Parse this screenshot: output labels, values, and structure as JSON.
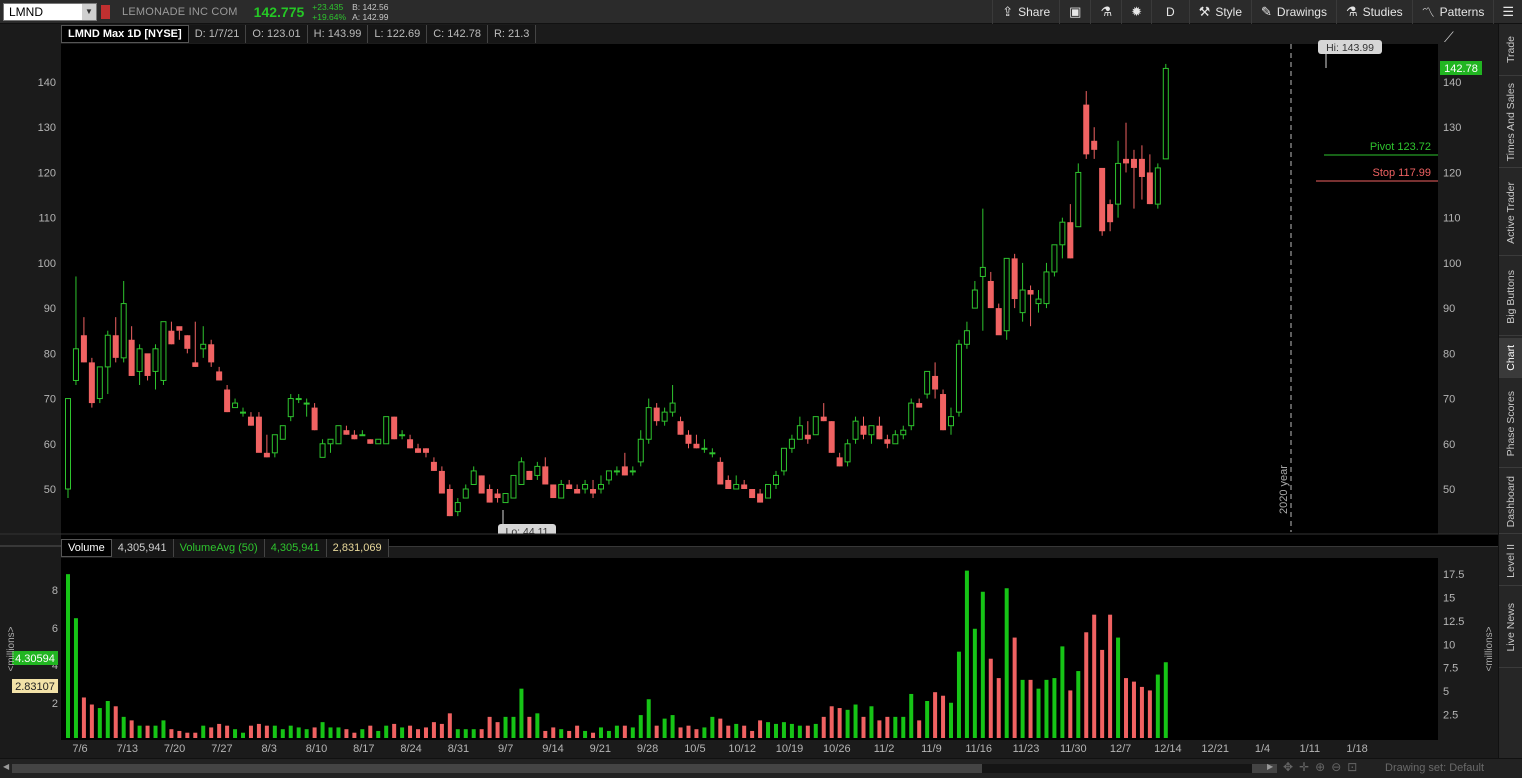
{
  "toolbar": {
    "symbol": "LMND",
    "company": "LEMONADE INC COM",
    "last": "142.775",
    "net_change": "+23.435",
    "pct_change": "+19.64%",
    "bid": "B: 142.56",
    "ask": "A: 142.99",
    "buttons": {
      "share": "Share",
      "period": "D",
      "style": "Style",
      "drawings": "Drawings",
      "studies": "Studies",
      "patterns": "Patterns"
    }
  },
  "price_header": {
    "title": "LMND Max 1D [NYSE]",
    "date": "D: 1/7/21",
    "open": "O: 123.01",
    "high": "H: 143.99",
    "low": "L: 122.69",
    "close": "C: 142.78",
    "range": "R: 21.3"
  },
  "volume_header": {
    "title": "Volume",
    "volume": "4,305,941",
    "avg_label": "VolumeAvg (50)",
    "avg_value": "4,305,941",
    "avg2": "2,831,069"
  },
  "annotations": {
    "hi": "Hi: 143.99",
    "lo": "Lo: 44.11",
    "pivot": "Pivot 123.72",
    "stop": "Stop 117.99",
    "last_price_tag": "142.78",
    "year_marker": "2020 year",
    "vol_tag_green": "4.30594",
    "vol_tag_yellow": "2.83107",
    "millions": "<millions>"
  },
  "sidebar": {
    "tabs": [
      "Trade",
      "Times And Sales",
      "Active Trader",
      "Big Buttons",
      "Chart",
      "Phase Scores",
      "Dashboard",
      "Level II",
      "Live News"
    ],
    "active": "Chart"
  },
  "status": {
    "drawing_set": "Drawing set: Default"
  },
  "colors": {
    "up": "#2ec42e",
    "down": "#f06262",
    "pivot": "#2ec42e",
    "stop": "#f06262"
  },
  "chart_data": {
    "type": "candlestick",
    "symbol": "LMND",
    "price_axis": {
      "ticks": [
        50,
        60,
        70,
        80,
        90,
        100,
        110,
        120,
        130,
        140
      ],
      "ylim": [
        40,
        148
      ]
    },
    "volume_axis_left": {
      "ticks": [
        2,
        4,
        6,
        8
      ],
      "unit": "<millions>"
    },
    "volume_axis_right": {
      "ticks": [
        "2.5",
        "5",
        "7.5",
        "10",
        "12.5",
        "15",
        "17.5"
      ],
      "unit": "<millions>"
    },
    "x_tick_labels": [
      "7/6",
      "7/13",
      "7/20",
      "7/27",
      "8/3",
      "8/10",
      "8/17",
      "8/24",
      "8/31",
      "9/7",
      "9/14",
      "9/21",
      "9/28",
      "10/5",
      "10/12",
      "10/19",
      "10/26",
      "11/2",
      "11/9",
      "11/16",
      "11/23",
      "11/30",
      "12/7",
      "12/14",
      "12/21",
      "1/4",
      "1/11",
      "1/18"
    ],
    "candles": [
      [
        50,
        70,
        48,
        70.0,
        9.3
      ],
      [
        74,
        97,
        73,
        81,
        6.8
      ],
      [
        84,
        88,
        78,
        78,
        2.3
      ],
      [
        78,
        79,
        68,
        69,
        1.9
      ],
      [
        70,
        77,
        69,
        77,
        1.7
      ],
      [
        77,
        85,
        71,
        84,
        2.1
      ],
      [
        84,
        88,
        78,
        79,
        1.8
      ],
      [
        79,
        96,
        78,
        91,
        1.2
      ],
      [
        83,
        86,
        75,
        75,
        1.0
      ],
      [
        76,
        82,
        73,
        81,
        0.7
      ],
      [
        80,
        79,
        74,
        75,
        0.7
      ],
      [
        76,
        82,
        72,
        81,
        0.7
      ],
      [
        74,
        87,
        73,
        87,
        1.0
      ],
      [
        85,
        87,
        82,
        82,
        0.5
      ],
      [
        86,
        85,
        83,
        85,
        0.4
      ],
      [
        84,
        84,
        80,
        81,
        0.3
      ],
      [
        78,
        87,
        77,
        77,
        0.3
      ],
      [
        81,
        86,
        79,
        82,
        0.7
      ],
      [
        82,
        83,
        77,
        78,
        0.6
      ],
      [
        76,
        77,
        74,
        74,
        0.8
      ],
      [
        72,
        73,
        67,
        67,
        0.7
      ],
      [
        68,
        70,
        68,
        69,
        0.5
      ],
      [
        67,
        68,
        66,
        67,
        0.3
      ],
      [
        66,
        67,
        64,
        64,
        0.7
      ],
      [
        66,
        67,
        59,
        58,
        0.8
      ],
      [
        58,
        62,
        57,
        57,
        0.7
      ],
      [
        58,
        62,
        57,
        62,
        0.7
      ],
      [
        61,
        64,
        61,
        64,
        0.5
      ],
      [
        66,
        71,
        65,
        70,
        0.7
      ],
      [
        70,
        71,
        69,
        70,
        0.6
      ],
      [
        69,
        70,
        66,
        69,
        0.5
      ],
      [
        68,
        69,
        63,
        63,
        0.6
      ],
      [
        57,
        61,
        57,
        60,
        0.9
      ],
      [
        60,
        61,
        58,
        61,
        0.6
      ],
      [
        60,
        64,
        60,
        64,
        0.6
      ],
      [
        63,
        64,
        62,
        62,
        0.5
      ],
      [
        62,
        63,
        61,
        61,
        0.3
      ],
      [
        62,
        63,
        62,
        62,
        0.5
      ],
      [
        61,
        61,
        60,
        60,
        0.7
      ],
      [
        60,
        61,
        60,
        61,
        0.4
      ],
      [
        60,
        66,
        60,
        66,
        0.7
      ],
      [
        66,
        66,
        61,
        61,
        0.8
      ],
      [
        62,
        63,
        61,
        62,
        0.6
      ],
      [
        61,
        62,
        59,
        59,
        0.7
      ],
      [
        59,
        60,
        58,
        58,
        0.5
      ],
      [
        59,
        59,
        57,
        58,
        0.6
      ],
      [
        56,
        57,
        54,
        54,
        0.9
      ],
      [
        54,
        55,
        49,
        49,
        0.8
      ],
      [
        50,
        51,
        44,
        44,
        1.4
      ],
      [
        45,
        48,
        44,
        47,
        0.5
      ],
      [
        48,
        51,
        48,
        50,
        0.5
      ],
      [
        51,
        55,
        51,
        54,
        0.5
      ],
      [
        53,
        53,
        49,
        49,
        0.5
      ],
      [
        50,
        51,
        47,
        47,
        1.2
      ],
      [
        49,
        50,
        47,
        48,
        0.9
      ],
      [
        47,
        49,
        47,
        49,
        1.2
      ],
      [
        48,
        53,
        48,
        53,
        1.2
      ],
      [
        51,
        57,
        51,
        56,
        2.8
      ],
      [
        54,
        54,
        52,
        52,
        1.2
      ],
      [
        53,
        56,
        52,
        55,
        1.4
      ],
      [
        55,
        57,
        51,
        51,
        0.4
      ],
      [
        51,
        51,
        48,
        48,
        0.6
      ],
      [
        48,
        52,
        48,
        51,
        0.5
      ],
      [
        51,
        52,
        50,
        50,
        0.4
      ],
      [
        50,
        51,
        49,
        49,
        0.7
      ],
      [
        50,
        52,
        49,
        51,
        0.4
      ],
      [
        50,
        52,
        48,
        49,
        0.3
      ],
      [
        50,
        53,
        49,
        51,
        0.6
      ],
      [
        52,
        54,
        51,
        54,
        0.4
      ],
      [
        54,
        55,
        53,
        54,
        0.7
      ],
      [
        55,
        58,
        53,
        53,
        0.7
      ],
      [
        54,
        55,
        53,
        54,
        0.6
      ],
      [
        56,
        63,
        55,
        61,
        1.3
      ],
      [
        61,
        70,
        60,
        68,
        2.2
      ],
      [
        68,
        69,
        64,
        65,
        0.7
      ],
      [
        65,
        68,
        64,
        67,
        1.1
      ],
      [
        67,
        73,
        66,
        69,
        1.3
      ],
      [
        65,
        66,
        62,
        62,
        0.6
      ],
      [
        62,
        63,
        59,
        60,
        0.7
      ],
      [
        60,
        62,
        59,
        59,
        0.5
      ],
      [
        59,
        61,
        58,
        59,
        0.6
      ],
      [
        58,
        59,
        57,
        58,
        1.2
      ],
      [
        56,
        57,
        51,
        51,
        1.1
      ],
      [
        52,
        53,
        50,
        50,
        0.7
      ],
      [
        50,
        53,
        50,
        51,
        0.8
      ],
      [
        51,
        52,
        50,
        50,
        0.7
      ],
      [
        50,
        50,
        48,
        48,
        0.4
      ],
      [
        49,
        50,
        47,
        47,
        1.0
      ],
      [
        48,
        51,
        48,
        51,
        0.9
      ],
      [
        51,
        54,
        50,
        53,
        0.8
      ],
      [
        54,
        59,
        53,
        59,
        0.9
      ],
      [
        59,
        62,
        58,
        61,
        0.8
      ],
      [
        61,
        66,
        61,
        64,
        0.7
      ],
      [
        62,
        65,
        60,
        61,
        0.7
      ],
      [
        62,
        66,
        62,
        66,
        0.8
      ],
      [
        66,
        69,
        65,
        65,
        1.2
      ],
      [
        65,
        65,
        58,
        58,
        1.8
      ],
      [
        57,
        58,
        55,
        55,
        1.7
      ],
      [
        56,
        61,
        55,
        60,
        1.6
      ],
      [
        61,
        66,
        60,
        65,
        1.9
      ],
      [
        64,
        66,
        61,
        62,
        1.2
      ],
      [
        62,
        64,
        60,
        64,
        1.8
      ],
      [
        64,
        66,
        61,
        61,
        1.0
      ],
      [
        61,
        62,
        59,
        60,
        1.2
      ],
      [
        60,
        63,
        60,
        62,
        1.2
      ],
      [
        62,
        64,
        61,
        63,
        1.2
      ],
      [
        64,
        70,
        63,
        69,
        2.5
      ],
      [
        69,
        70,
        68,
        68,
        1.0
      ],
      [
        71,
        76,
        70,
        76,
        2.1
      ],
      [
        75,
        78,
        70,
        72,
        2.6
      ],
      [
        71,
        72,
        63,
        63,
        2.4
      ],
      [
        64,
        68,
        62,
        66,
        2.0
      ],
      [
        67,
        83,
        66,
        82,
        4.9
      ],
      [
        82,
        87,
        81,
        85,
        9.5
      ],
      [
        90,
        96,
        90,
        94,
        6.2
      ],
      [
        97,
        112,
        85,
        99,
        8.3
      ],
      [
        96,
        98,
        91,
        90,
        4.5
      ],
      [
        90,
        91,
        85,
        84,
        3.4
      ],
      [
        85,
        101,
        83,
        101,
        8.5
      ],
      [
        101,
        102,
        90,
        92,
        5.7
      ],
      [
        89,
        100,
        87,
        94,
        3.3
      ],
      [
        94,
        95,
        86,
        93,
        3.3
      ],
      [
        91,
        94,
        89,
        92,
        2.8
      ],
      [
        91,
        100,
        90,
        98,
        3.3
      ],
      [
        98,
        104,
        97,
        104,
        3.4
      ],
      [
        104,
        110,
        101,
        109,
        5.2
      ],
      [
        109,
        113,
        101,
        101,
        2.7
      ],
      [
        108,
        122,
        108,
        120,
        3.8
      ],
      [
        135,
        138,
        123,
        124,
        6.0
      ],
      [
        127,
        130,
        123,
        125,
        7.0
      ],
      [
        121,
        116,
        106,
        107,
        5.0
      ],
      [
        113,
        114,
        107,
        109,
        7.0
      ],
      [
        113,
        127,
        110,
        122,
        5.7
      ],
      [
        123,
        131,
        120,
        122,
        3.4
      ],
      [
        123,
        125,
        112,
        121,
        3.2
      ],
      [
        123,
        126,
        114,
        119,
        2.9
      ],
      [
        120,
        124,
        113,
        113,
        2.7
      ],
      [
        113,
        122,
        112,
        121,
        3.6
      ],
      [
        123,
        144,
        123,
        143,
        4.3
      ]
    ]
  }
}
